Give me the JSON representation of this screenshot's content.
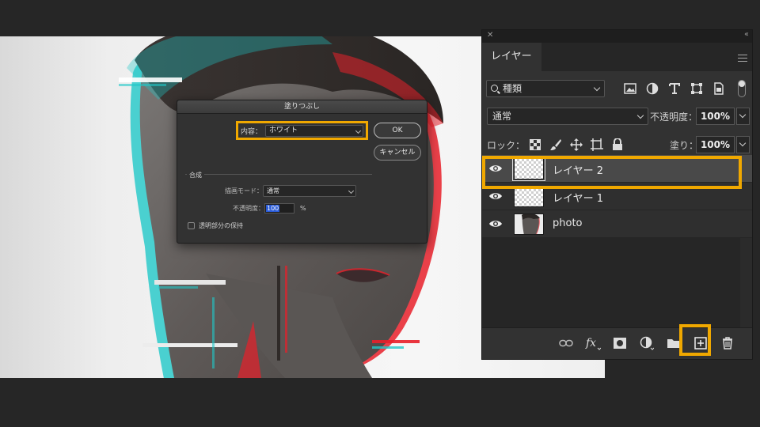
{
  "dialog": {
    "title": "塗りつぶし",
    "content_label": "内容：",
    "content_value": "ホワイト",
    "ok_label": "OK",
    "cancel_label": "キャンセル",
    "blend_group_title": "合成",
    "mode_label": "描画モード：",
    "mode_value": "通常",
    "opacity_label": "不透明度：",
    "opacity_value": "100",
    "opacity_unit": "%",
    "preserve_label": "透明部分の保持"
  },
  "panel": {
    "close_glyph": "✕",
    "collapse_glyph": "‹‹",
    "tab_label": "レイヤー",
    "filter_kind": "種類",
    "blend_mode": "通常",
    "opacity_label": "不透明度：",
    "opacity_value": "100%",
    "lock_label": "ロック：",
    "fill_label": "塗り：",
    "fill_value": "100%",
    "layers": [
      {
        "name": "レイヤー 2",
        "selected": true
      },
      {
        "name": "レイヤー 1",
        "selected": false
      },
      {
        "name": "photo",
        "selected": false
      }
    ]
  },
  "colors": {
    "highlight": "#f0a800",
    "panel_bg": "#323232",
    "app_bg": "#262626",
    "glitch_red": "#e8202a",
    "glitch_cyan": "#20c8c8"
  },
  "icons": [
    "eye-icon",
    "link-icon",
    "fx-icon",
    "mask-icon",
    "adjustment-icon",
    "folder-icon",
    "new-layer-icon",
    "trash-icon"
  ]
}
